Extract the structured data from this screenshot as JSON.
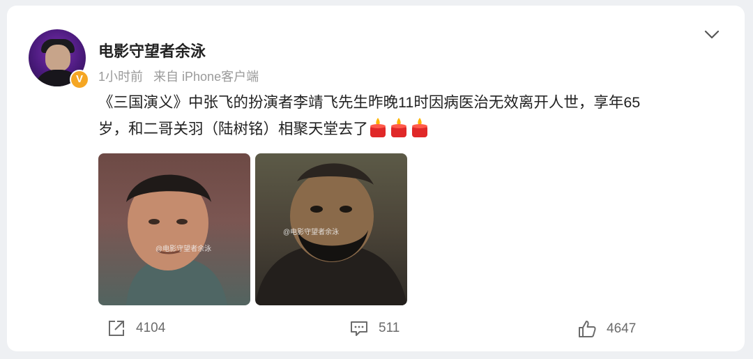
{
  "post": {
    "username": "电影守望者余泳",
    "time": "1小时前",
    "source": "来自 iPhone客户端",
    "verified_badge": "V",
    "text_line1": "《三国演义》中张飞的扮演者李靖飞先生昨晚11时因病医治无效离开人世，享年65",
    "text_line2": "岁，和二哥关羽（陆树铭）相聚天堂去了",
    "images": [
      {
        "watermark": "@电影守望者余泳"
      },
      {
        "watermark": "@电影守望者余泳"
      }
    ]
  },
  "actions": {
    "repost_count": "4104",
    "comment_count": "511",
    "like_count": "4647"
  },
  "icons": {
    "menu": "chevron-down-icon",
    "repost": "share-icon",
    "comment": "comment-icon",
    "like": "thumbs-up-icon",
    "emoji": "candle-emoji-icon"
  },
  "colors": {
    "badge": "#f5a623",
    "background": "#eef0f3",
    "card": "#ffffff"
  }
}
